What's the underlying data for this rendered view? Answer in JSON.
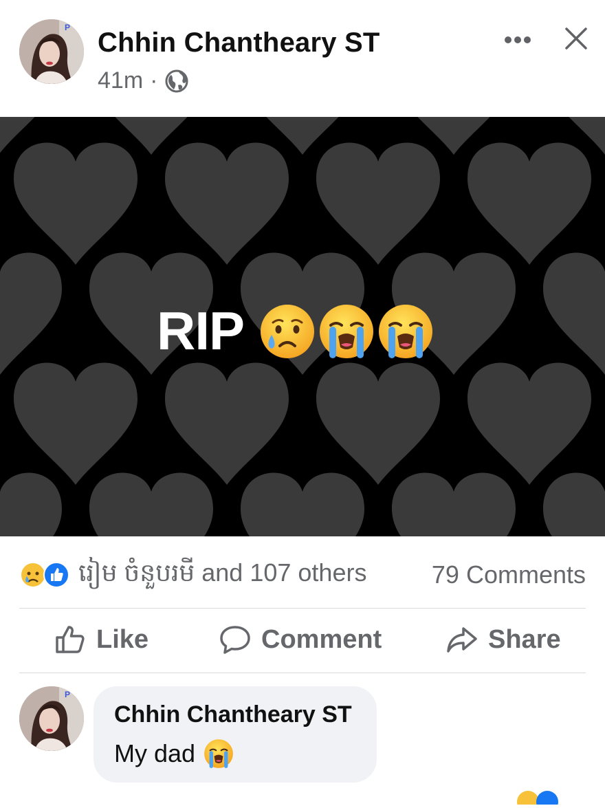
{
  "post": {
    "author": "Chhin Chantheary ST",
    "time": "41m",
    "separator": "·",
    "privacy_icon": "globe-icon",
    "image_text": "RIP",
    "image_emojis": [
      "crying-face-emoji",
      "loudly-crying-face-emoji",
      "loudly-crying-face-emoji"
    ]
  },
  "reactions": {
    "icons": [
      "sad-reaction-icon",
      "like-reaction-icon"
    ],
    "names_text": "រៀម ចំនួបរមី and 107 others",
    "comments_text": "79 Comments"
  },
  "actions": {
    "like": "Like",
    "comment": "Comment",
    "share": "Share"
  },
  "comment": {
    "author": "Chhin Chantheary ST",
    "text": "My dad",
    "emoji": "loudly-crying-face-emoji"
  },
  "colors": {
    "secondary_text": "#65676b",
    "like_blue": "#1877f2",
    "bubble_bg": "#f0f2f5",
    "heart_gray": "#3b3b3b"
  }
}
